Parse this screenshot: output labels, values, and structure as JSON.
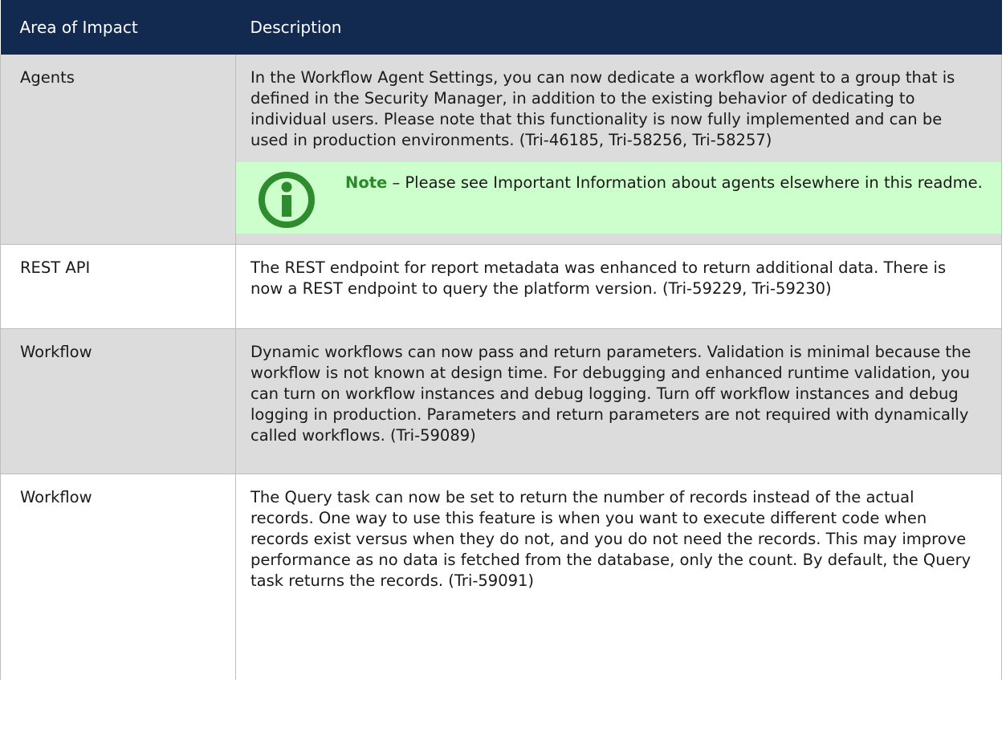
{
  "table": {
    "headers": [
      "Area of Impact",
      "Description"
    ],
    "rows": [
      {
        "area": "Agents",
        "description": "In the Workflow Agent Settings, you can now dedicate a workflow agent to a group that is defined in the Security Manager, in addition to the existing behavior of dedicating to individual users. Please note that this functionality is now fully implemented and can be used in production environments. (Tri-46185, Tri-58256, Tri-58257)",
        "note": {
          "label": "Note",
          "separator": " – ",
          "text": "Please see Important Information about agents elsewhere in this readme.",
          "icon": "info-icon",
          "icon_color": "#2e8b2e",
          "background": "#ccffcc"
        }
      },
      {
        "area": "REST API",
        "description": "The REST endpoint for report metadata was enhanced to return additional data. There is now a REST endpoint to query the platform version. (Tri-59229, Tri-59230)"
      },
      {
        "area": "Workflow",
        "description": "Dynamic workflows can now pass and return parameters. Validation is minimal because the workflow is not known at design time. For debugging and enhanced runtime validation, you can turn on workflow instances and debug logging. Turn off workflow instances and debug logging in production. Parameters and return parameters are not required with dynamically called workflows. (Tri-59089)"
      },
      {
        "area": "Workflow",
        "description": "The Query task can now be set to return the number of records instead of the actual records. One way to use this feature is when you want to execute different code when records exist versus when they do not, and you do not need the records. This may improve performance as no data is fetched from the database, only the count. By default, the Query task returns the records. (Tri-59091)"
      }
    ]
  },
  "colors": {
    "header_bg": "#122a50",
    "header_text": "#ffffff",
    "shaded_row": "#dcdcdc",
    "note_label": "#2a8a2a"
  }
}
